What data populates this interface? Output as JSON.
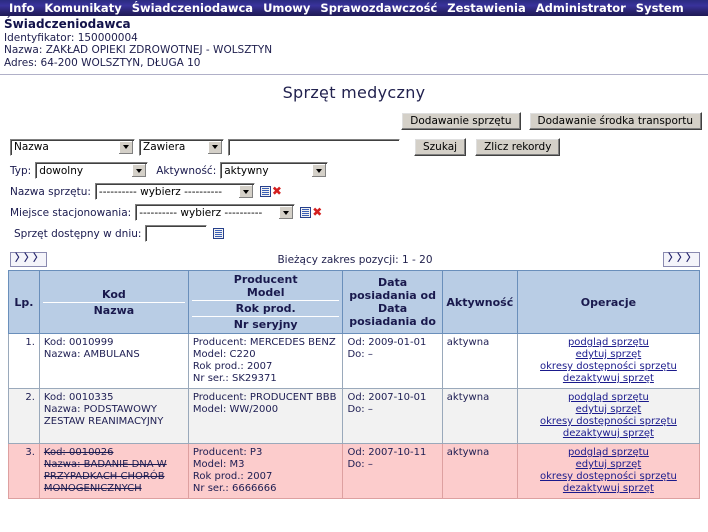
{
  "menu": {
    "items": [
      {
        "label": "Info",
        "name": "menu-info"
      },
      {
        "label": "Komunikaty",
        "name": "menu-komunikaty"
      },
      {
        "label": "Świadczeniodawca",
        "name": "menu-swiadczeniodawca"
      },
      {
        "label": "Umowy",
        "name": "menu-umowy"
      },
      {
        "label": "Sprawozdawczość",
        "name": "menu-sprawozdawczosc"
      },
      {
        "label": "Zestawienia",
        "name": "menu-zestawienia"
      },
      {
        "label": "Administrator",
        "name": "menu-administrator"
      },
      {
        "label": "System",
        "name": "menu-system"
      }
    ]
  },
  "provider": {
    "title": "Świadczeniodawca",
    "identyfikator": "Identyfikator: 150000004",
    "nazwa": "Nazwa: ZAKŁAD OPIEKI ZDROWOTNEJ - WOLSZTYN",
    "adres": "Adres: 64-200 WOLSZTYN, DŁUGA 10"
  },
  "page": {
    "title": "Sprzęt medyczny"
  },
  "toolbar": {
    "add_equipment": "Dodawanie sprzętu",
    "add_transport": "Dodawanie środka transportu"
  },
  "search": {
    "field_select": "Nazwa",
    "operator_select": "Zawiera",
    "query_value": "",
    "query_placeholder": "",
    "search_button": "Szukaj",
    "count_button": "Zlicz rekordy",
    "typ_label": "Typ:",
    "typ_value": "dowolny",
    "aktywnosc_label": "Aktywność:",
    "aktywnosc_value": "aktywny",
    "nazwa_sprzetu_label": "Nazwa sprzętu:",
    "nazwa_sprzetu_value": "---------- wybierz ----------",
    "miejsce_label": "Miejsce stacjonowania:",
    "miejsce_value": "---------- wybierz ----------",
    "dostepny_label": "Sprzęt dostępny w dniu:",
    "dostepny_value": ""
  },
  "pagination": {
    "prev_label": "〉〉〉",
    "next_label": "〉〉〉",
    "range_text": "Bieżący zakres pozycji: 1 - 20"
  },
  "table": {
    "headers": {
      "lp": "Lp.",
      "kod": "Kod",
      "nazwa": "Nazwa",
      "producent": "Producent",
      "model": "Model",
      "rok_prod": "Rok prod.",
      "nr_seryjny": "Nr seryjny",
      "data_od": "Data\nposiadania od",
      "data_od_l1": "Data",
      "data_od_l2": "posiadania od",
      "data_do_l1": "Data",
      "data_do_l2": "posiadania do",
      "aktywnosc": "Aktywność",
      "operacje": "Operacje"
    },
    "ops_labels": {
      "podglad": "podgląd sprzętu",
      "edytuj": "edytuj sprzęt",
      "okresy": "okresy dostępności sprzętu",
      "dezaktywuj": "dezaktywuj sprzęt"
    },
    "rows": [
      {
        "lp": "1.",
        "kod": "Kod: 0010999",
        "nazwa": "Nazwa: AMBULANS",
        "producent": "Producent: MERCEDES BENZ",
        "model": "Model: C220",
        "rok": "Rok prod.: 2007",
        "nr": "Nr ser.: SK29371",
        "od": "Od: 2009-01-01",
        "do": "Do: –",
        "aktywnosc": "aktywna",
        "flagged": false,
        "alt": false
      },
      {
        "lp": "2.",
        "kod": "Kod: 0010335",
        "nazwa": "Nazwa: PODSTAWOWY ZESTAW REANIMACYJNY",
        "producent": "Producent: PRODUCENT BBB",
        "model": "Model: WW/2000",
        "rok": "",
        "nr": "",
        "od": "Od: 2007-10-01",
        "do": "Do: –",
        "aktywnosc": "aktywna",
        "flagged": false,
        "alt": true
      },
      {
        "lp": "3.",
        "kod": "Kod: 0010026",
        "nazwa": "Nazwa: BADANIE DNA W PRZYPADKACH CHORÓB MONOGENICZNYCH",
        "producent": "Producent: P3",
        "model": "Model: M3",
        "rok": "Rok prod.: 2007",
        "nr": "Nr ser.: 6666666",
        "od": "Od: 2007-10-11",
        "do": "Do: –",
        "aktywnosc": "aktywna",
        "flagged": true,
        "alt": false
      }
    ]
  },
  "colors": {
    "menu_bg": "#2b2b80",
    "header_bg": "#b9cde5",
    "flag_row_bg": "#fccccc",
    "link": "#1a1a8c",
    "accent_x": "#d42020"
  }
}
